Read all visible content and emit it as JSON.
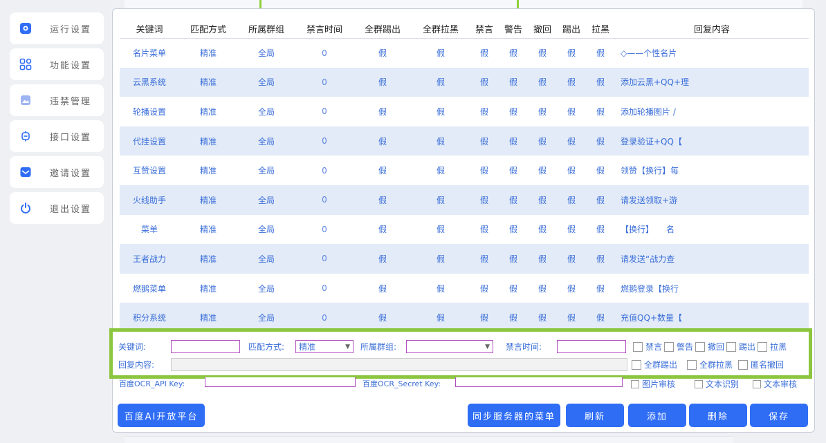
{
  "top_ghost_text": "…………",
  "sidebar": {
    "items": [
      {
        "label": "运行设置",
        "icon": "settings-icon"
      },
      {
        "label": "功能设置",
        "icon": "grid-icon"
      },
      {
        "label": "违禁管理",
        "icon": "picture-icon"
      },
      {
        "label": "接口设置",
        "icon": "chip-icon"
      },
      {
        "label": "邀请设置",
        "icon": "mail-icon"
      },
      {
        "label": "退出设置",
        "icon": "power-icon"
      }
    ]
  },
  "table": {
    "headers": [
      "关键词",
      "匹配方式",
      "所属群组",
      "禁言时间",
      "全群踢出",
      "全群拉黑",
      "禁言",
      "警告",
      "撤回",
      "踢出",
      "拉黑",
      "回复内容"
    ],
    "rows": [
      [
        "名片菜单",
        "精准",
        "全局",
        "0",
        "假",
        "假",
        "假",
        "假",
        "假",
        "假",
        "假",
        "◇——个性名片"
      ],
      [
        "云黑系统",
        "精准",
        "全局",
        "0",
        "假",
        "假",
        "假",
        "假",
        "假",
        "假",
        "假",
        "添加云黑+QQ+理"
      ],
      [
        "轮播设置",
        "精准",
        "全局",
        "0",
        "假",
        "假",
        "假",
        "假",
        "假",
        "假",
        "假",
        "添加轮播图片 /"
      ],
      [
        "代挂设置",
        "精准",
        "全局",
        "0",
        "假",
        "假",
        "假",
        "假",
        "假",
        "假",
        "假",
        "登录验证+QQ【"
      ],
      [
        "互赞设置",
        "精准",
        "全局",
        "0",
        "假",
        "假",
        "假",
        "假",
        "假",
        "假",
        "假",
        "领赞【换行】每"
      ],
      [
        "火线助手",
        "精准",
        "全局",
        "0",
        "假",
        "假",
        "假",
        "假",
        "假",
        "假",
        "假",
        "请发送领取+游"
      ],
      [
        "菜单",
        "精准",
        "全局",
        "0",
        "假",
        "假",
        "假",
        "假",
        "假",
        "假",
        "假",
        "【换行】　　名"
      ],
      [
        "王者战力",
        "精准",
        "全局",
        "0",
        "假",
        "假",
        "假",
        "假",
        "假",
        "假",
        "假",
        "请发送“战力查"
      ],
      [
        "燃鹅菜单",
        "精准",
        "全局",
        "0",
        "假",
        "假",
        "假",
        "假",
        "假",
        "假",
        "假",
        "燃鹅登录【换行"
      ],
      [
        "积分系统",
        "精准",
        "全局",
        "0",
        "假",
        "假",
        "假",
        "假",
        "假",
        "假",
        "假",
        "充值QQ+数量【"
      ]
    ]
  },
  "form": {
    "keyword_label": "关键词:",
    "match_label": "匹配方式:",
    "match_value": "精准",
    "group_label": "所属群组:",
    "group_value": "",
    "mute_time_label": "禁言时间:",
    "reply_label": "回复内容:",
    "checks_row1": [
      "禁言",
      "警告",
      "撤回",
      "踢出",
      "拉黑"
    ],
    "checks_row2": [
      "全群踢出",
      "全群拉黑",
      "匿名撤回"
    ]
  },
  "underlay": {
    "api_key_label": "百度OCR_API Key:",
    "secret_key_label": "百度OCR_Secret Key:",
    "checks": [
      "图片审核",
      "文本识别",
      "文本审核"
    ]
  },
  "buttons": {
    "baidu_ai": "百度AI开放平台",
    "sync_menu": "同步服务器的菜单",
    "refresh": "刷新",
    "add": "添加",
    "delete": "删除",
    "save": "保存"
  }
}
